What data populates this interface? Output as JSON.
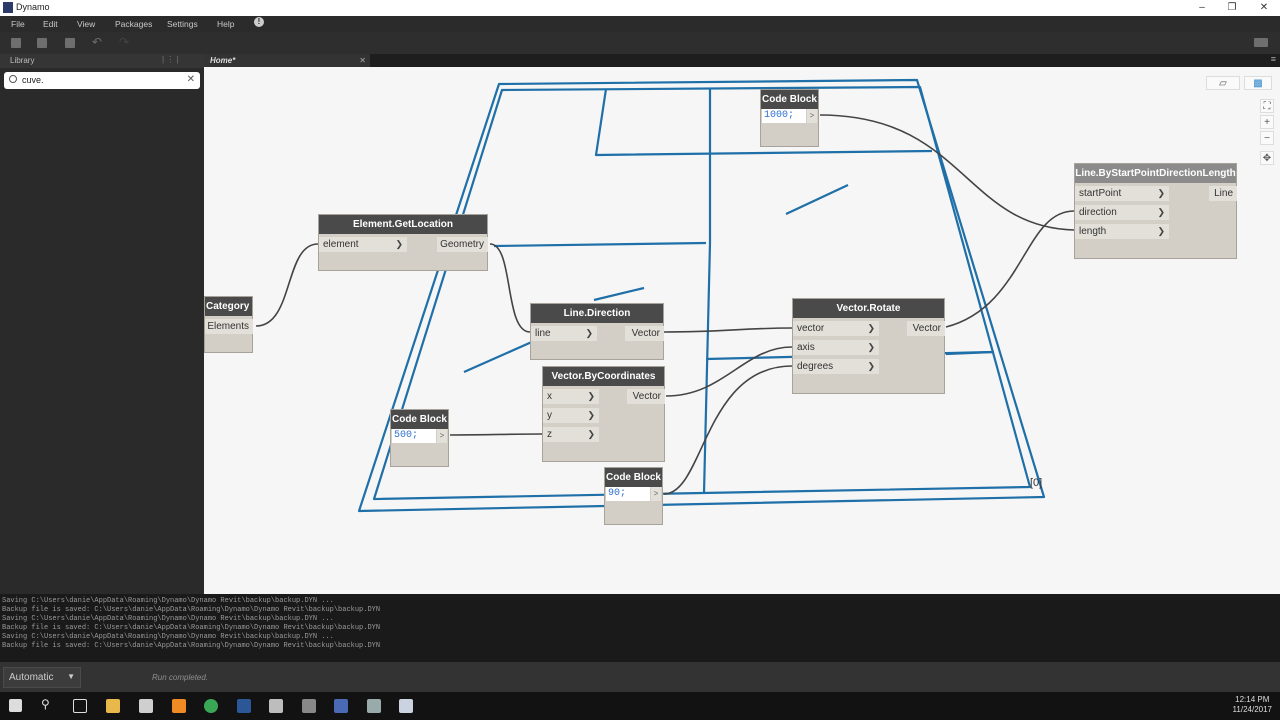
{
  "window": {
    "title": "Dynamo"
  },
  "menu": [
    "File",
    "Edit",
    "View",
    "Packages",
    "Settings",
    "Help"
  ],
  "library": {
    "header": "Library",
    "search_value": "cuve."
  },
  "tabs": [
    {
      "label": "Home*"
    }
  ],
  "nodes": {
    "category": {
      "title": "Category",
      "outputs": [
        "Elements"
      ]
    },
    "get_location": {
      "title": "Element.GetLocation",
      "inputs": [
        "element"
      ],
      "outputs": [
        "Geometry"
      ]
    },
    "line_direction": {
      "title": "Line.Direction",
      "inputs": [
        "line"
      ],
      "outputs": [
        "Vector"
      ]
    },
    "vector_by_coords": {
      "title": "Vector.ByCoordinates",
      "inputs": [
        "x",
        "y",
        "z"
      ],
      "outputs": [
        "Vector"
      ]
    },
    "vector_rotate": {
      "title": "Vector.Rotate",
      "inputs": [
        "vector",
        "axis",
        "degrees"
      ],
      "outputs": [
        "Vector"
      ]
    },
    "line_by_spdl": {
      "title": "Line.ByStartPointDirectionLength",
      "inputs": [
        "startPoint",
        "direction",
        "length"
      ],
      "outputs": [
        "Line"
      ]
    },
    "code_1000": {
      "title": "Code Block",
      "code": "1000;",
      "out": ">"
    },
    "code_500": {
      "title": "Code Block",
      "code": "500;",
      "out": ">"
    },
    "code_90": {
      "title": "Code Block",
      "code": "90;",
      "out": ">"
    }
  },
  "canvas_label": "[0]",
  "console": [
    "Saving C:\\Users\\danie\\AppData\\Roaming\\Dynamo\\Dynamo Revit\\backup\\backup.DYN ...",
    "Backup file is saved: C:\\Users\\danie\\AppData\\Roaming\\Dynamo\\Dynamo Revit\\backup\\backup.DYN",
    "Saving C:\\Users\\danie\\AppData\\Roaming\\Dynamo\\Dynamo Revit\\backup\\backup.DYN ...",
    "Backup file is saved: C:\\Users\\danie\\AppData\\Roaming\\Dynamo\\Dynamo Revit\\backup\\backup.DYN",
    "Saving C:\\Users\\danie\\AppData\\Roaming\\Dynamo\\Dynamo Revit\\backup\\backup.DYN ...",
    "Backup file is saved: C:\\Users\\danie\\AppData\\Roaming\\Dynamo\\Dynamo Revit\\backup\\backup.DYN"
  ],
  "run": {
    "mode": "Automatic",
    "status": "Run completed."
  },
  "taskbar": {
    "time": "12:14 PM",
    "date": "11/24/2017"
  },
  "colors": {
    "geometry": "#1f6fa8",
    "node_header": "#4a4a4a",
    "node_body": "#d3cfc6",
    "wire": "#444444"
  }
}
